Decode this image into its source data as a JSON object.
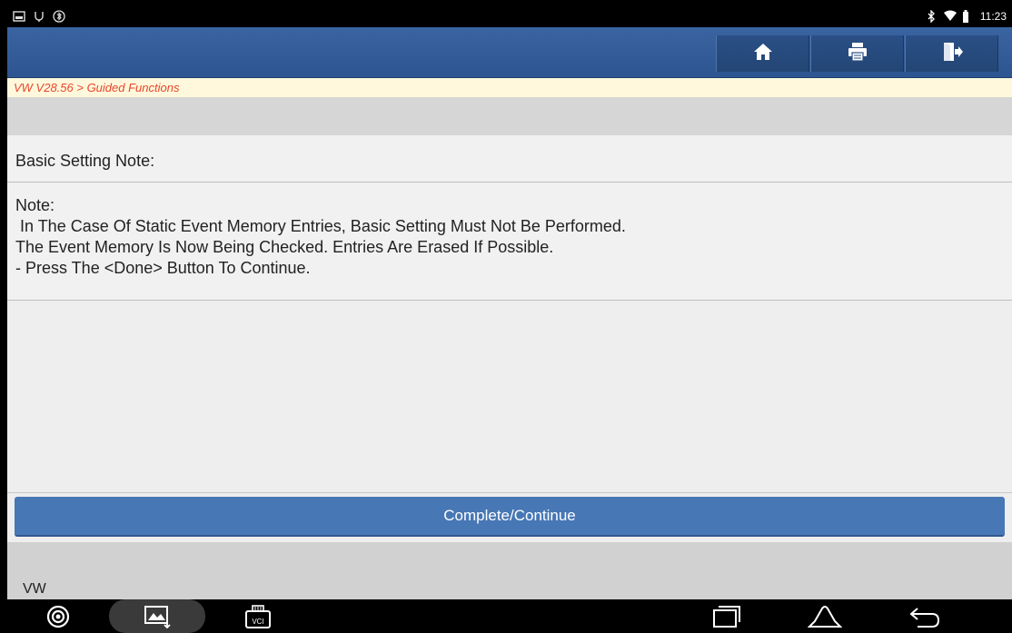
{
  "status_bar": {
    "time": "11:23",
    "left_icons": [
      "screenshot-icon",
      "usb-debug-icon",
      "bluetooth-settings-icon"
    ],
    "right_icons": [
      "bluetooth-icon",
      "wifi-icon",
      "battery-icon"
    ]
  },
  "appbar": {
    "buttons": [
      {
        "name": "home-button",
        "icon": "home-icon"
      },
      {
        "name": "print-button",
        "icon": "printer-icon"
      },
      {
        "name": "exit-button",
        "icon": "exit-icon"
      }
    ]
  },
  "breadcrumb": "VW V28.56 > Guided Functions",
  "section_title": "Basic Setting Note:",
  "note": {
    "lines": [
      "Note:",
      " In The Case Of Static Event Memory Entries, Basic Setting Must Not Be Performed.",
      "The Event Memory Is Now Being Checked. Entries Are Erased If Possible.",
      "- Press The <Done> Button To Continue."
    ]
  },
  "primary_button": "Complete/Continue",
  "footer_label": "VW",
  "nav": {
    "vci_label": "VCI",
    "items": [
      "browser-icon",
      "gallery-icon",
      "vci-icon",
      "recent-apps-icon",
      "home-nav-icon",
      "back-icon"
    ]
  },
  "colors": {
    "appbar": "#2d5590",
    "breadcrumb_text": "#e8452b",
    "breadcrumb_bg": "#fff8dc",
    "button": "#4777b5"
  }
}
